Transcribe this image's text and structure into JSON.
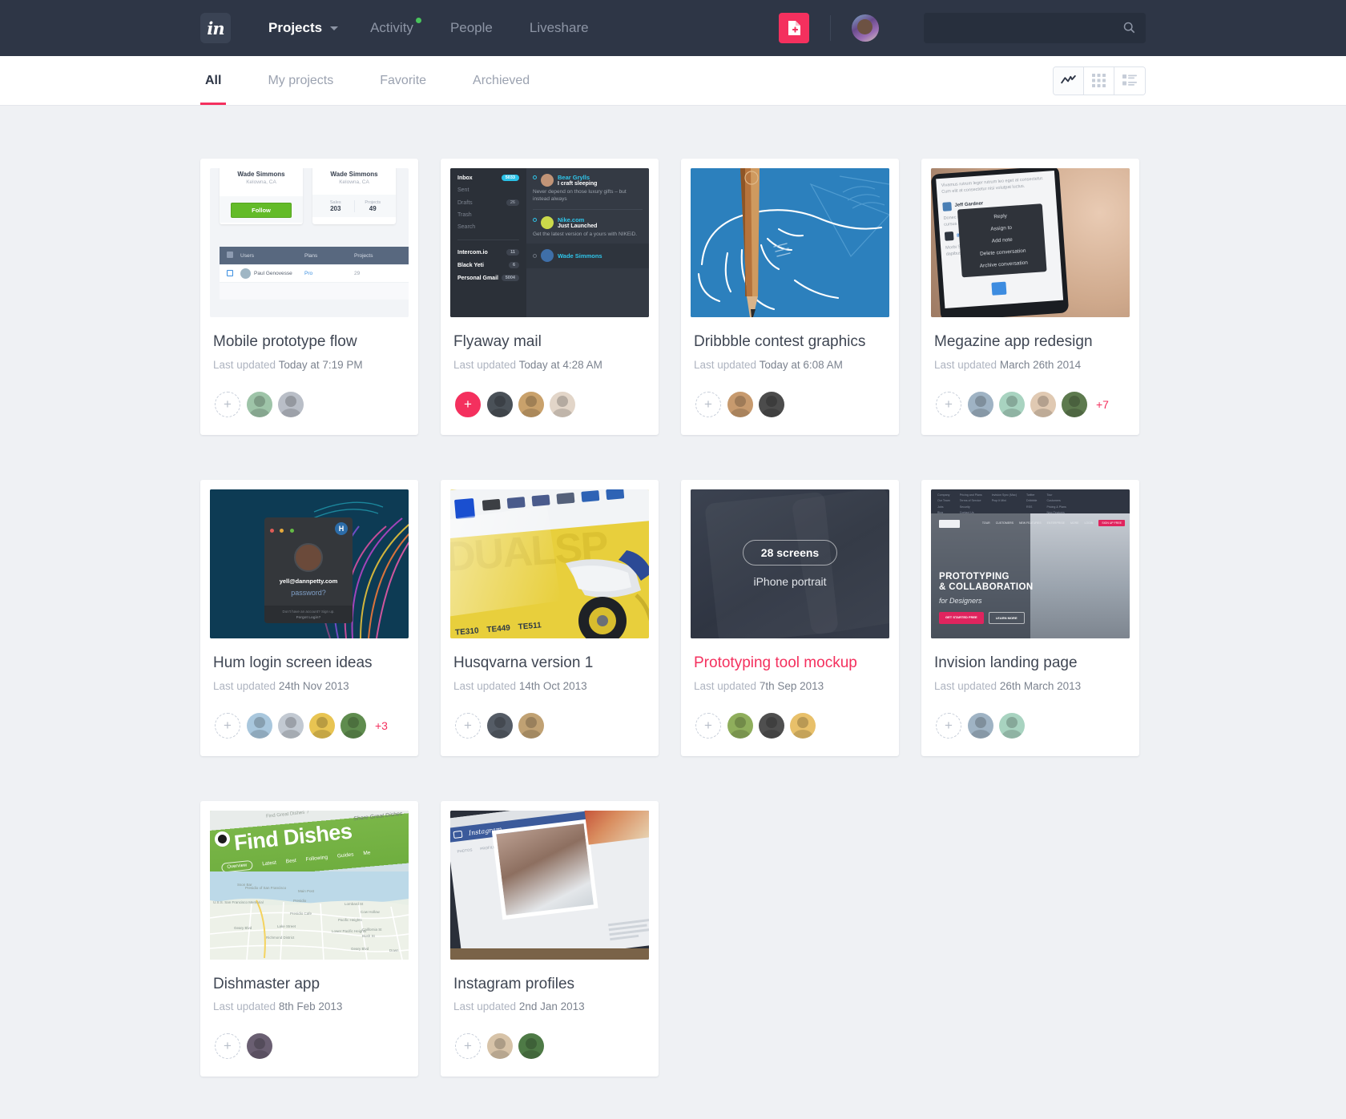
{
  "brand": {
    "logo_text": "in",
    "accent": "#f4305e",
    "nav_bg": "#2e3646"
  },
  "nav": {
    "primary_label": "Projects",
    "links": [
      {
        "label": "Activity",
        "has_badge": true
      },
      {
        "label": "People",
        "has_badge": false
      },
      {
        "label": "Liveshare",
        "has_badge": false
      }
    ],
    "new_project_icon": "document-plus-icon",
    "avatar_icon": "user-avatar",
    "search": {
      "value": "",
      "placeholder": "",
      "icon": "search-icon"
    }
  },
  "tabbar": {
    "tabs": [
      {
        "label": "All",
        "active": true
      },
      {
        "label": "My projects",
        "active": false
      },
      {
        "label": "Favorite",
        "active": false
      },
      {
        "label": "Archieved",
        "active": false
      }
    ],
    "views": [
      {
        "name": "activity-view",
        "icon": "activity-chart-icon",
        "active": true
      },
      {
        "name": "grid-view",
        "icon": "grid-icon",
        "active": false
      },
      {
        "name": "list-view",
        "icon": "list-icon",
        "active": false
      }
    ]
  },
  "meta_prefix": "Last updated",
  "projects": [
    {
      "title": "Mobile prototype flow",
      "updated": "Today at 7:19 PM",
      "title_hot": false,
      "add_filled": false,
      "avatars": 2,
      "more": "",
      "thumb": {
        "kind": "profile-dashboard",
        "name": "Wade Simmons",
        "location": "Kelowna, CA",
        "follow_label": "Follow",
        "stats": [
          {
            "label": "Sales",
            "value": "203"
          },
          {
            "label": "Projects",
            "value": "49"
          }
        ],
        "columns": [
          "Users",
          "Plans",
          "Projects"
        ],
        "row": {
          "user": "Paul Genovesse",
          "plan": "Pro",
          "projects": "29"
        }
      }
    },
    {
      "title": "Flyaway mail",
      "updated": "Today at 4:28 AM",
      "title_hot": false,
      "add_filled": true,
      "avatars": 3,
      "more": "",
      "thumb": {
        "kind": "mail-client",
        "folders": [
          {
            "label": "Inbox",
            "count": "5033",
            "active": true,
            "blue": true
          },
          {
            "label": "Sent",
            "count": "",
            "active": false
          },
          {
            "label": "Drafts",
            "count": "26",
            "active": false
          },
          {
            "label": "Trash",
            "count": "",
            "active": false
          },
          {
            "label": "Search",
            "count": "",
            "active": false
          }
        ],
        "accounts": [
          {
            "label": "Intercom.io",
            "count": "11"
          },
          {
            "label": "Black Yeti",
            "count": "6"
          },
          {
            "label": "Personal Gmail",
            "count": "5004"
          }
        ],
        "messages": [
          {
            "from": "Bear Grylls",
            "subject": "I craft sleeping",
            "preview": "Never depend on those luxury gifts – but instead always"
          },
          {
            "from": "Nike.com",
            "subject": "Just Launched",
            "preview": "Get the latest version of a yours with NIKEiD."
          },
          {
            "from": "Wade Simmons",
            "subject": "",
            "preview": ""
          }
        ]
      }
    },
    {
      "title": "Dribbble contest graphics",
      "updated": "Today at 6:08 AM",
      "title_hot": false,
      "add_filled": false,
      "avatars": 2,
      "more": "",
      "thumb": {
        "kind": "pencil-illustration",
        "alt": "blue illustration of a hand drawn with a wooden pencil"
      }
    },
    {
      "title": "Megazine app redesign",
      "updated": "March 26th 2014",
      "title_hot": false,
      "add_filled": false,
      "avatars": 4,
      "more": "+7",
      "thumb": {
        "kind": "phone-photo",
        "person": "Jeff Gardner",
        "menu": [
          "Reply",
          "Assign to",
          "Add note",
          "Delete conversation",
          "Archive conversation"
        ]
      }
    },
    {
      "title": "Hum login screen ideas",
      "updated": "24th Nov 2013",
      "title_hot": false,
      "add_filled": false,
      "avatars": 4,
      "more": "+3",
      "thumb": {
        "kind": "login-window",
        "logo": "H",
        "email": "yell@dannpetty.com",
        "password_label": "password?",
        "footer": "Don't have an account? Sign up.",
        "footer2": "Forgot Login?"
      }
    },
    {
      "title": "Husqvarna version 1",
      "updated": "14th Oct 2013",
      "title_hot": false,
      "add_filled": false,
      "avatars": 2,
      "more": "",
      "thumb": {
        "kind": "moto-site",
        "headline": "DUALSP",
        "models": [
          "TE310",
          "TE449",
          "TE511"
        ]
      }
    },
    {
      "title": "Prototyping tool mockup",
      "updated": "7th Sep 2013",
      "title_hot": true,
      "add_filled": false,
      "avatars": 3,
      "more": "",
      "thumb": {
        "kind": "screens-overlay",
        "screens_badge": "28 screens",
        "device_label": "iPhone portrait"
      }
    },
    {
      "title": "Invision landing page",
      "updated": "26th March 2013",
      "title_hot": false,
      "add_filled": false,
      "avatars": 2,
      "more": "",
      "thumb": {
        "kind": "landing-page",
        "headline1": "PROTOTYPING",
        "headline2": "& COLLABORATION",
        "sub": "for Designers",
        "cta": "GET STARTED FREE",
        "cta2": "LEARN MORE"
      }
    },
    {
      "title": "Dishmaster app",
      "updated": "8th Feb 2013",
      "title_hot": false,
      "add_filled": false,
      "avatars": 1,
      "more": "",
      "thumb": {
        "kind": "dishes-map",
        "logo": "Find Dishes",
        "tagline": "Share Great Dishes",
        "nav": [
          "Overview",
          "Latest",
          "Best",
          "Following",
          "Guides",
          "Me"
        ]
      }
    },
    {
      "title": "Instagram profiles",
      "updated": "2nd Jan 2013",
      "title_hot": false,
      "add_filled": false,
      "avatars": 2,
      "more": "",
      "thumb": {
        "kind": "instagram-photo",
        "brand": "Instagram"
      }
    }
  ]
}
